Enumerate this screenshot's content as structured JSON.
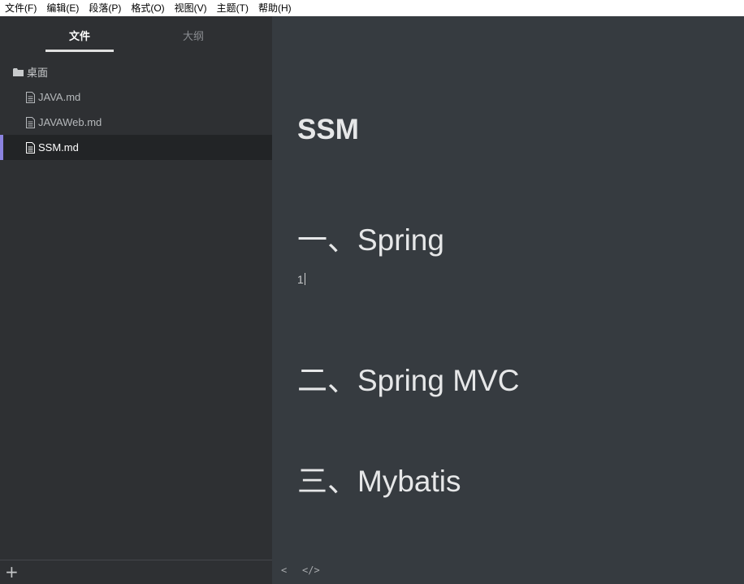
{
  "menubar": {
    "items": [
      "文件(F)",
      "编辑(E)",
      "段落(P)",
      "格式(O)",
      "视图(V)",
      "主题(T)",
      "帮助(H)"
    ]
  },
  "sidebar": {
    "tabs": {
      "files": "文件",
      "outline": "大纲"
    },
    "folder": {
      "label": "桌面",
      "icon": "folder-icon"
    },
    "files": [
      {
        "label": "JAVA.md",
        "icon": "file-icon",
        "active": false
      },
      {
        "label": "JAVAWeb.md",
        "icon": "file-icon",
        "active": false
      },
      {
        "label": "SSM.md",
        "icon": "file-icon",
        "active": true
      }
    ],
    "footer": {
      "add_label": "+"
    }
  },
  "editor": {
    "title": "SSM",
    "sections": [
      {
        "heading": "一、Spring",
        "body": "1"
      },
      {
        "heading": "二、Spring MVC"
      },
      {
        "heading": "三、Mybatis"
      }
    ],
    "footer": {
      "back_label": "<",
      "source_label": "</>"
    }
  },
  "colors": {
    "accent": "#8b83e0",
    "sidebar_bg": "#2e3033",
    "editor_bg": "#363b40"
  }
}
